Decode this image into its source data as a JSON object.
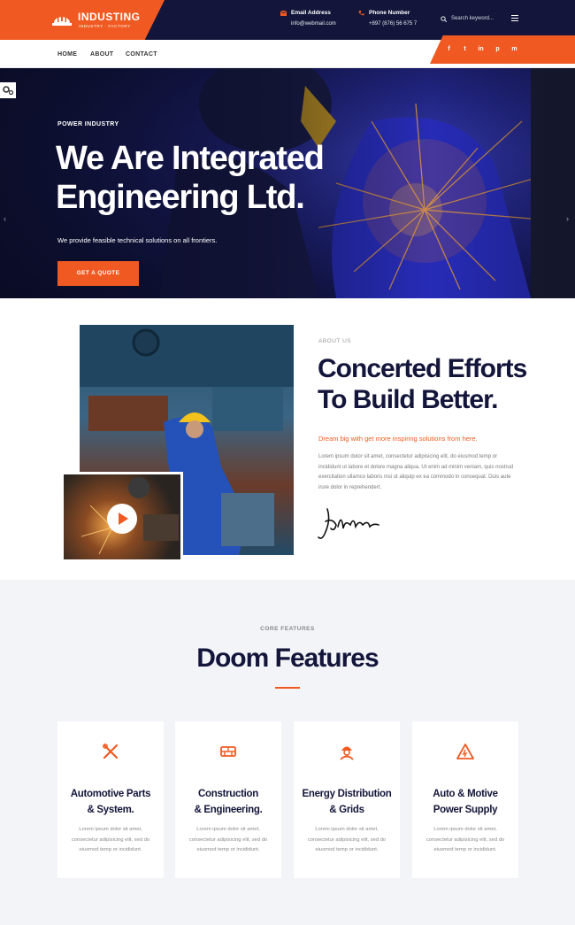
{
  "brand": {
    "name": "INDUSTING",
    "tagline": "INDUSTRY · FACTORY",
    "accent": "#f05a22",
    "navy": "#13163a"
  },
  "topbar": {
    "email_label": "Email Address",
    "email_value": "info@webmail.com",
    "phone_label": "Phone Number",
    "phone_value": "+897 (876) 56 675 7",
    "search_placeholder": "Search keyword...",
    "icons": [
      "mail-icon",
      "phone-icon",
      "search-icon",
      "menu-icon"
    ]
  },
  "nav": {
    "items": [
      "HOME",
      "ABOUT",
      "CONTACT"
    ],
    "social": [
      "f",
      "t",
      "in",
      "p",
      "m"
    ]
  },
  "hero": {
    "kicker": "POWER INDUSTRY",
    "title_line1": "We Are Integrated",
    "title_line2": "Engineering Ltd.",
    "subtitle": "We provide feasible technical solutions on all frontiers.",
    "button": "GET A QUOTE"
  },
  "about": {
    "kicker": "ABOUT US",
    "title_line1": "Concerted Efforts",
    "title_line2": "To Build Better.",
    "lead": "Dream big with get more inspiring solutions from here.",
    "body": "Lorem ipsum dolor sit amet, consectetur adipisicing elit, do eiusmod temp or incididunt ut labore et dolore magna aliqua. Ut enim ad minim veniam, quis nostrud exercitation ullamco laboris nisi ut aliquip ex ea commodo in consequat. Duis aute irure dolor in reprehendert."
  },
  "features": {
    "kicker": "CORE FEATURES",
    "title": "Doom Features",
    "cards": [
      {
        "title_line1": "Automotive Parts",
        "title_line2": "& System.",
        "body": "Lorem ipsum dolor sit amet, consectetur adipisicing elit, sed do eiusmod temp or incididunt.",
        "icon": "wrench-icon"
      },
      {
        "title_line1": "Construction",
        "title_line2": "& Engineering.",
        "body": "Lorem ipsum dolor sit amet, consectetur adipisicing elit, sed do eiusmod temp or incididunt.",
        "icon": "bricks-icon"
      },
      {
        "title_line1": "Energy Distribution",
        "title_line2": "& Grids",
        "body": "Lorem ipsum dolor sit amet, consectetur adipisicing elit, sed do eiusmod temp or incididunt.",
        "icon": "worker-icon"
      },
      {
        "title_line1": "Auto & Motive",
        "title_line2": "Power Supply",
        "body": "Lorem ipsum dolor sit amet, consectetur adipisicing elit, sed do eiusmod temp or incididunt.",
        "icon": "warning-icon"
      }
    ]
  }
}
